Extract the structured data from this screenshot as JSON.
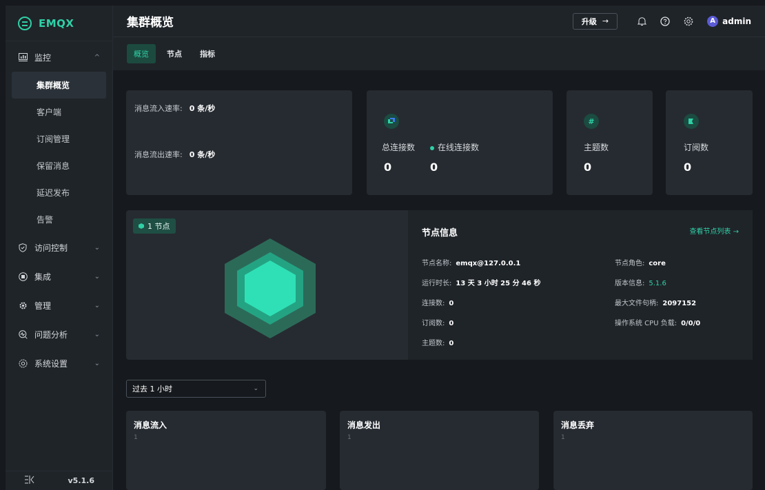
{
  "logo": {
    "text": "EMQX"
  },
  "sidebar": {
    "monitor": {
      "label": "监控",
      "chevron": "^"
    },
    "monitor_items": [
      {
        "label": "集群概览",
        "active": true
      },
      {
        "label": "客户端"
      },
      {
        "label": "订阅管理"
      },
      {
        "label": "保留消息"
      },
      {
        "label": "延迟发布"
      },
      {
        "label": "告警"
      }
    ],
    "groups": [
      {
        "label": "访问控制",
        "icon": "shield-icon"
      },
      {
        "label": "集成",
        "icon": "integration-icon"
      },
      {
        "label": "管理",
        "icon": "manage-icon"
      },
      {
        "label": "问题分析",
        "icon": "diagnose-icon"
      },
      {
        "label": "系统设置",
        "icon": "settings-icon"
      }
    ],
    "footer": {
      "collapse_icon": "collapse-icon",
      "version": "v5.1.6"
    }
  },
  "header": {
    "title": "集群概览",
    "upgrade_label": "升级",
    "upgrade_arrow": "→",
    "avatar_letter": "A",
    "username": "admin"
  },
  "tabs": [
    {
      "label": "概览",
      "active": true
    },
    {
      "label": "节点"
    },
    {
      "label": "指标"
    }
  ],
  "rates": {
    "in_label": "消息流入速率:",
    "in_value": "0 条/秒",
    "out_label": "消息流出速率:",
    "out_value": "0 条/秒"
  },
  "connections": {
    "total_label": "总连接数",
    "online_label": "在线连接数",
    "total_value": "0",
    "online_value": "0"
  },
  "topics": {
    "label": "主题数",
    "value": "0",
    "icon_glyph": "#"
  },
  "subscriptions": {
    "label": "订阅数",
    "value": "0"
  },
  "node": {
    "badge": "1 节点",
    "info_title": "节点信息",
    "list_link": "查看节点列表 →",
    "name_label": "节点名称:",
    "name_value": "emqx@127.0.0.1",
    "uptime_label": "运行时长:",
    "uptime_value": "13 天 3 小时 25 分 46 秒",
    "conn_label": "连接数:",
    "conn_value": "0",
    "sub_label": "订阅数:",
    "sub_value": "0",
    "topic_label": "主题数:",
    "topic_value": "0",
    "role_label": "节点角色:",
    "role_value": "core",
    "version_label": "版本信息:",
    "version_value": "5.1.6",
    "fd_label": "最大文件句柄:",
    "fd_value": "2097152",
    "cpu_label": "操作系统 CPU 负载:",
    "cpu_value": "0/0/0"
  },
  "range_select": {
    "value": "过去 1 小时"
  },
  "charts": [
    {
      "title": "消息流入",
      "tick": "1"
    },
    {
      "title": "消息发出",
      "tick": "1"
    },
    {
      "title": "消息丢弃",
      "tick": "1"
    }
  ],
  "colors": {
    "accent": "#2fd0a6",
    "bg": "#16191d",
    "card": "#262b31",
    "sidebar": "#1f2429"
  }
}
